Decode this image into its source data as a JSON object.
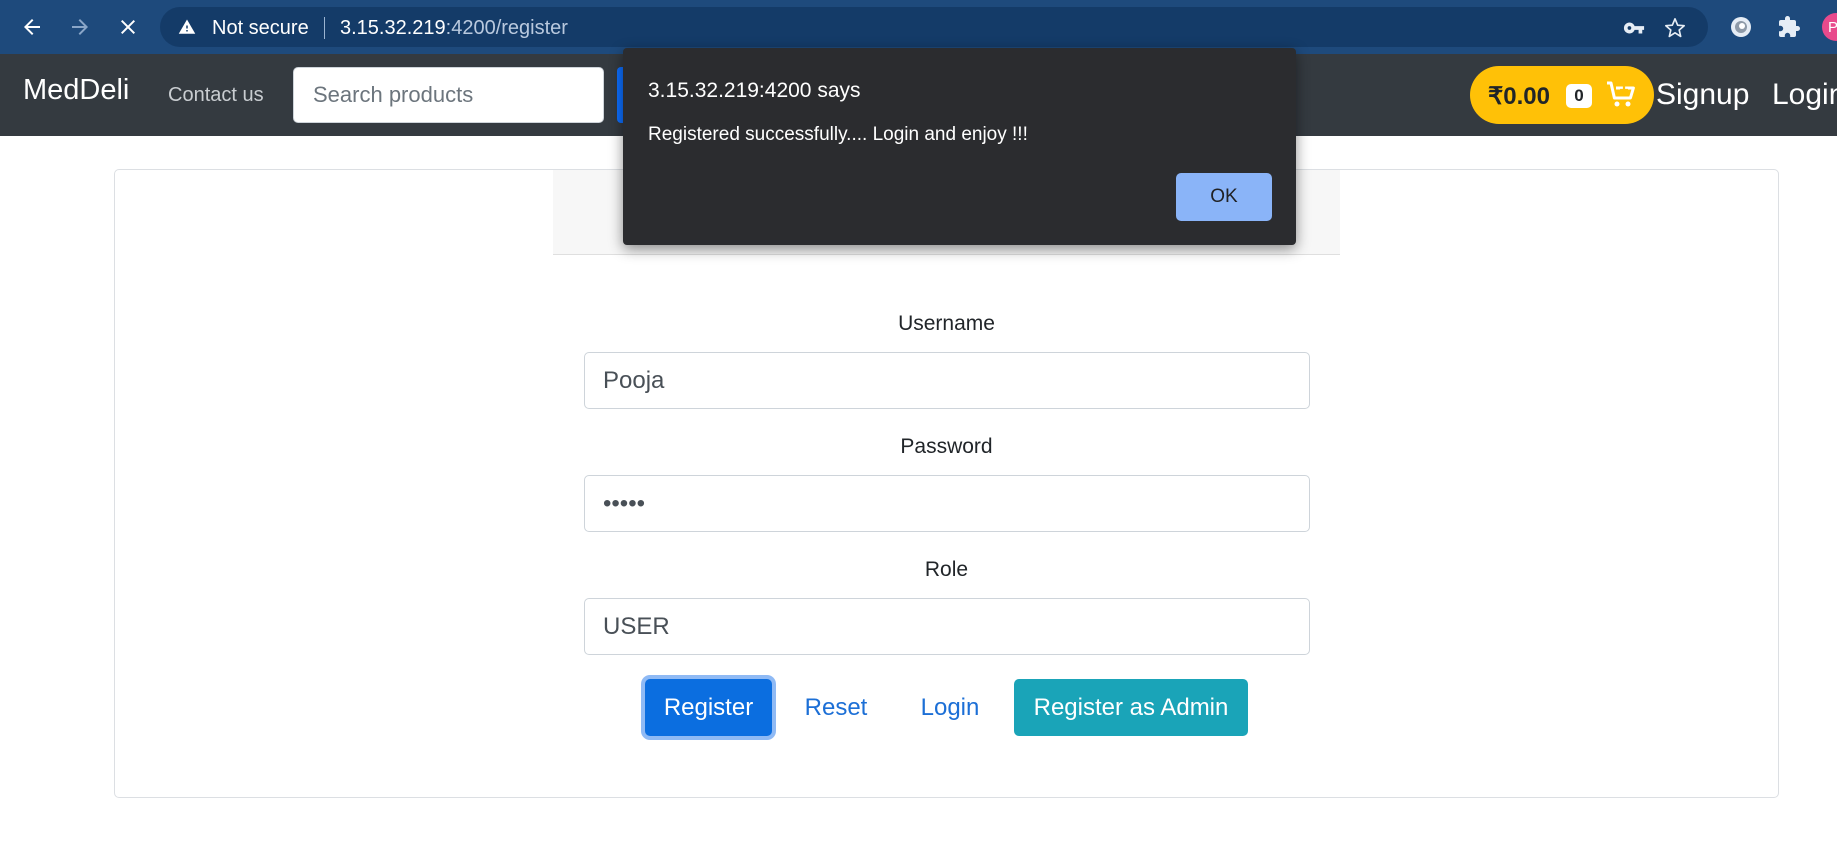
{
  "browser": {
    "security_label": "Not secure",
    "url_host": "3.15.32.219",
    "url_path": ":4200/register",
    "profile_initial": "P"
  },
  "navbar": {
    "brand": "MedDeli",
    "contact_label": "Contact us",
    "search_placeholder": "Search products",
    "cart_total": "₹0.00",
    "cart_count": "0",
    "signup_label": "Signup",
    "login_label": "Login"
  },
  "form": {
    "username_label": "Username",
    "username_value": "Pooja",
    "password_label": "Password",
    "password_value": "•••••",
    "role_label": "Role",
    "role_value": "USER",
    "register_button": "Register",
    "reset_button": "Reset",
    "login_button": "Login",
    "register_admin_button": "Register as Admin"
  },
  "dialog": {
    "title": "3.15.32.219:4200 says",
    "message": "Registered successfully.... Login and enjoy !!!",
    "ok_button": "OK"
  },
  "colors": {
    "browser_bar": "#1e4a7c",
    "navbar": "#343a40",
    "cart_pill": "#ffc107",
    "primary": "#0b6ee0",
    "info": "#1aa4b8",
    "dialog_bg": "#2b2c2f",
    "dialog_button": "#8ab4f8"
  }
}
